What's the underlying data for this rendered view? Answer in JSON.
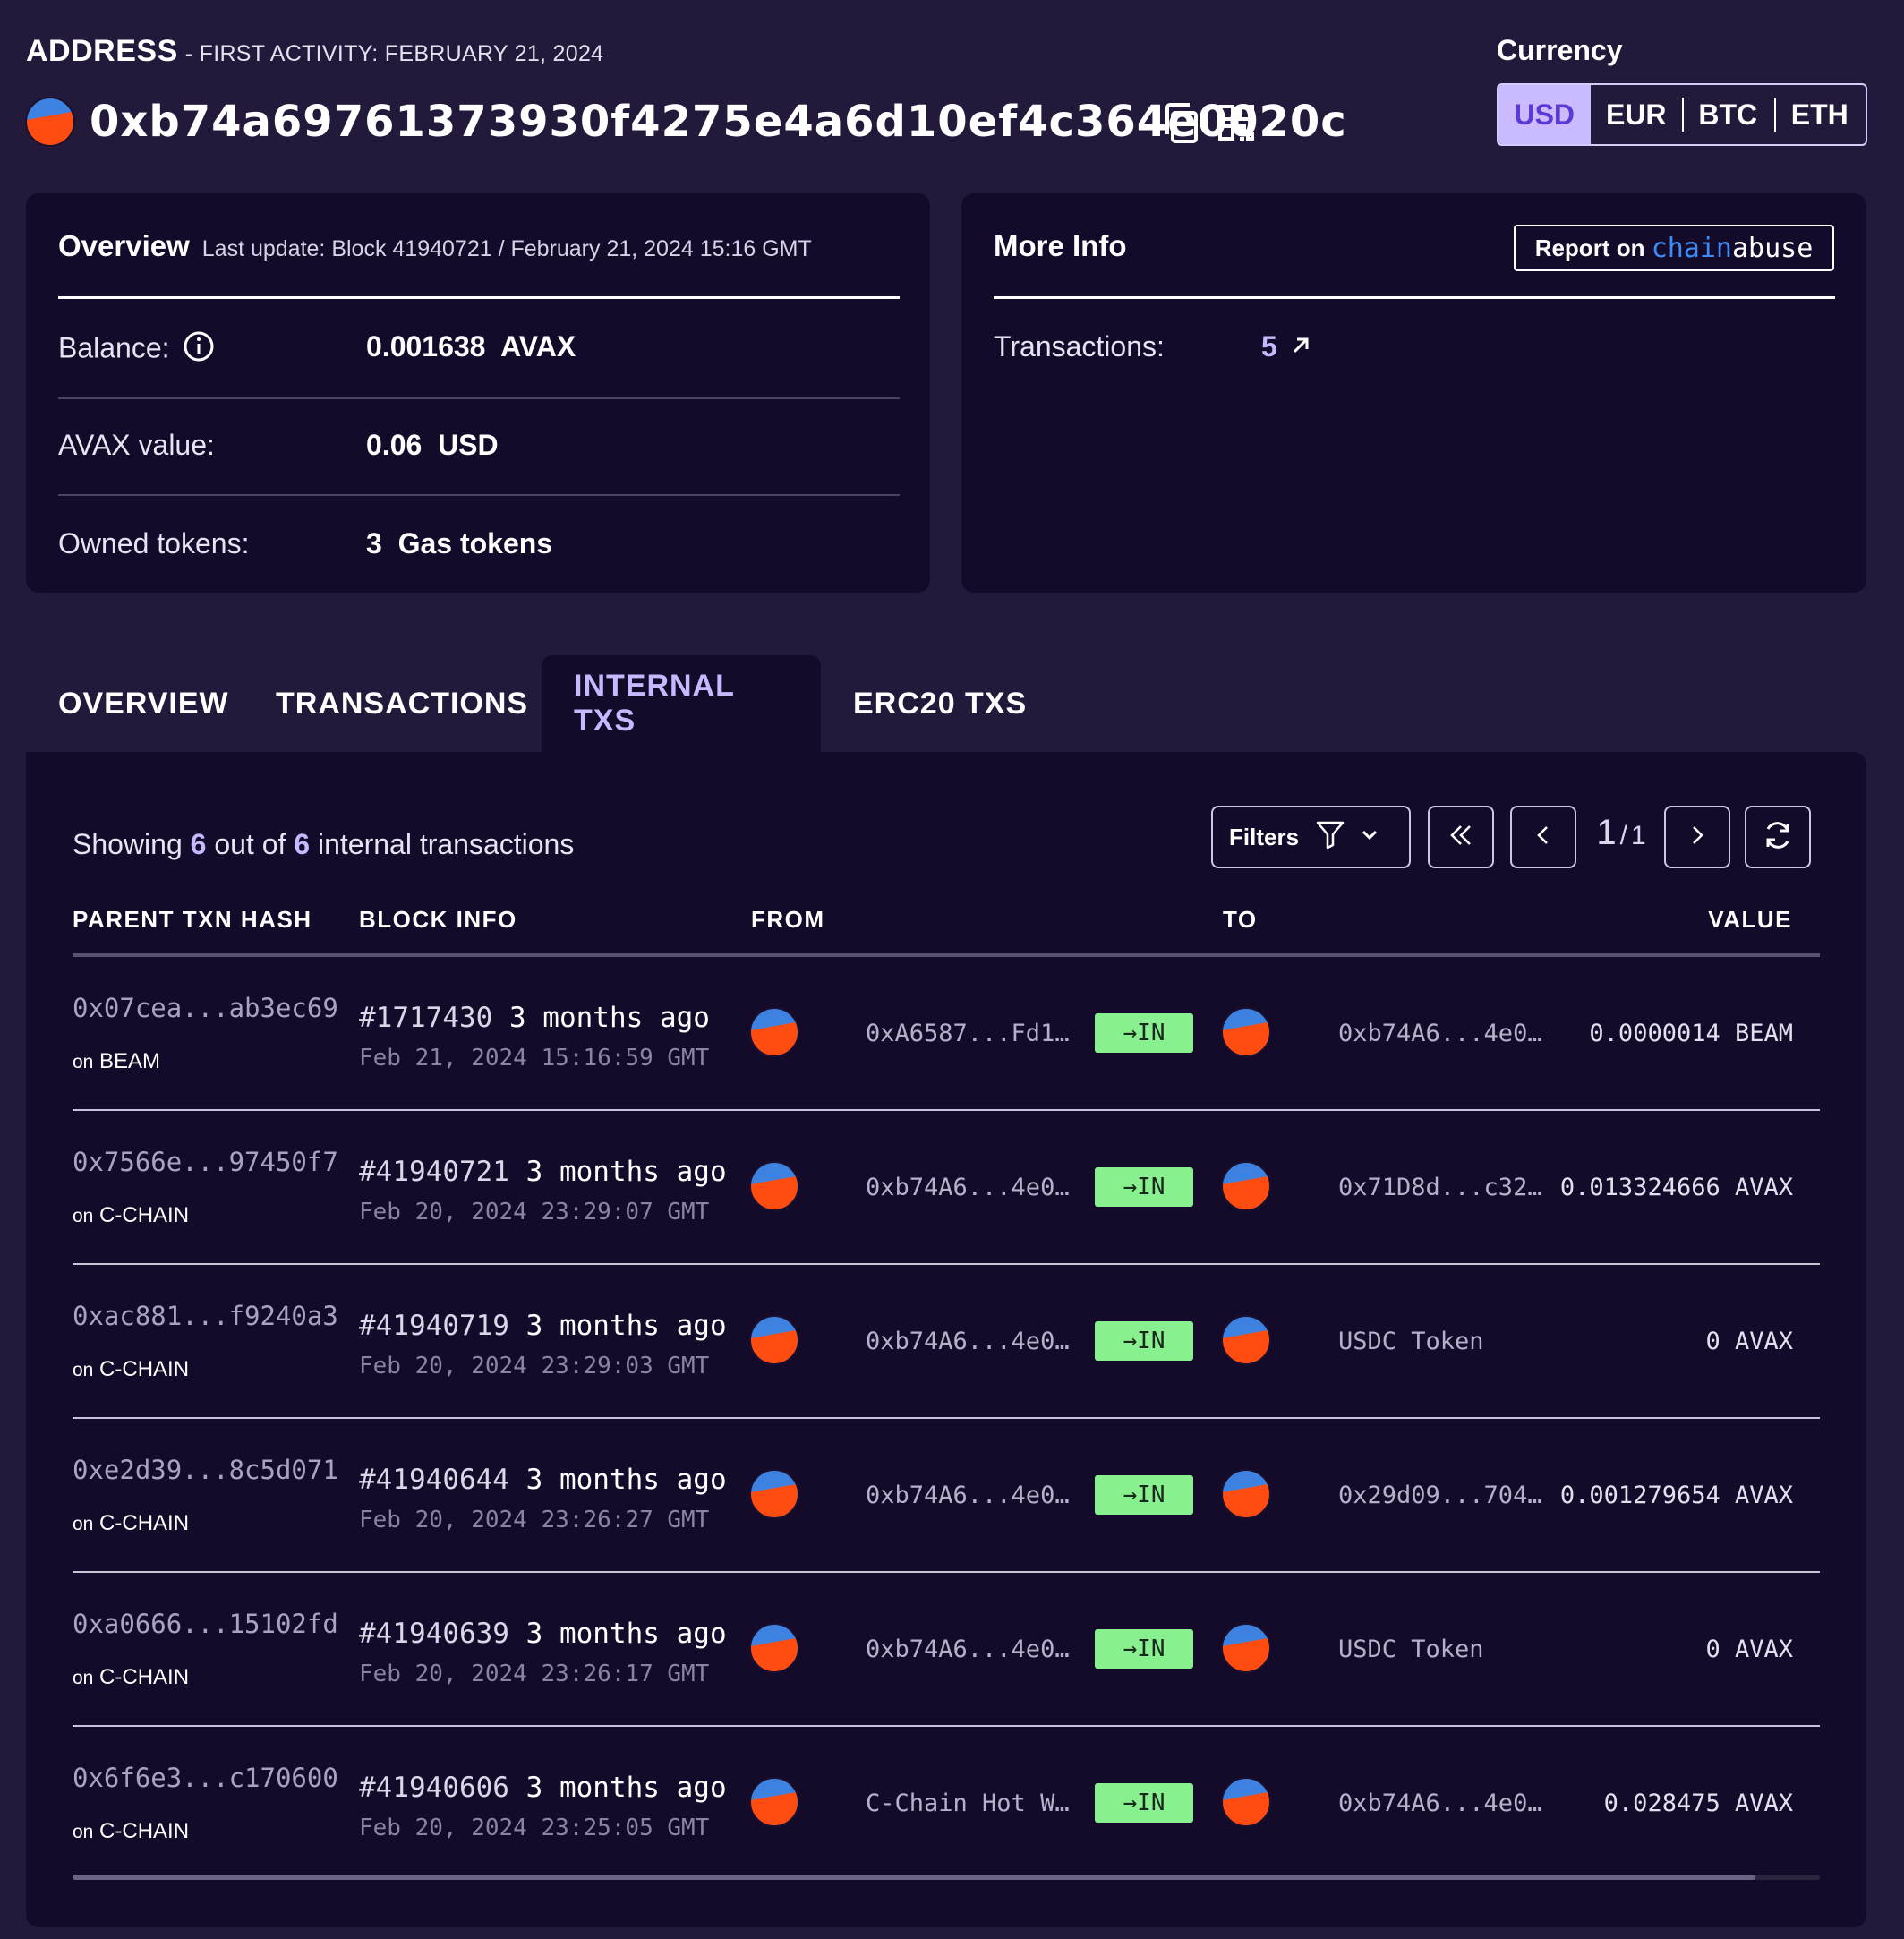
{
  "header": {
    "address_label": "ADDRESS",
    "first_activity": "- FIRST ACTIVITY: FEBRUARY 21, 2024",
    "address": "0xb74a69761373930f4275e4a6d10ef4c364e0020c",
    "copy_icon": "copy-icon",
    "qr_icon": "qr-code-icon"
  },
  "currency": {
    "label": "Currency",
    "options": [
      "USD",
      "EUR",
      "BTC",
      "ETH"
    ],
    "selected": "USD"
  },
  "overview": {
    "title": "Overview",
    "last_update": "Last update: Block 41940721 / February 21, 2024 15:16 GMT",
    "balance_label": "Balance:",
    "balance_value": "0.001638  AVAX",
    "avax_value_label": "AVAX value:",
    "avax_value": "0.06  USD",
    "owned_tokens_label": "Owned tokens:",
    "owned_tokens_count": "3",
    "owned_tokens_text": "Gas tokens"
  },
  "more_info": {
    "title": "More Info",
    "report_prefix": "Report on",
    "report_brand_a": "chain",
    "report_brand_b": "abuse",
    "transactions_label": "Transactions:",
    "transactions_value": "5"
  },
  "tabs": [
    "OVERVIEW",
    "TRANSACTIONS",
    "INTERNAL TXS",
    "ERC20 TXS"
  ],
  "active_tab": "INTERNAL TXS",
  "table": {
    "showing_prefix": "Showing",
    "showing_count": "6",
    "showing_mid": "out of",
    "showing_total": "6",
    "showing_suffix": "internal transactions",
    "filters_label": "Filters",
    "page_current": "1",
    "page_sep": "/",
    "page_total": "1",
    "columns": [
      "PARENT TXN HASH",
      "BLOCK INFO",
      "FROM",
      "TO",
      "VALUE"
    ],
    "rows": [
      {
        "hash": "0x07cea...ab3ec69",
        "chain_prefix": "on",
        "chain": "BEAM",
        "block": "#1717430",
        "age": "3 months ago",
        "date": "Feb 21, 2024 15:16:59 GMT",
        "from": "0xA6587...Fd1…",
        "direction": "→IN",
        "to": "0xb74A6...4e0…",
        "value": "0.0000014 BEAM"
      },
      {
        "hash": "0x7566e...97450f7",
        "chain_prefix": "on",
        "chain": "C-CHAIN",
        "block": "#41940721",
        "age": "3 months ago",
        "date": "Feb 20, 2024 23:29:07 GMT",
        "from": "0xb74A6...4e0…",
        "direction": "→IN",
        "to": "0x71D8d...c32…",
        "value": "0.013324666 AVAX"
      },
      {
        "hash": "0xac881...f9240a3",
        "chain_prefix": "on",
        "chain": "C-CHAIN",
        "block": "#41940719",
        "age": "3 months ago",
        "date": "Feb 20, 2024 23:29:03 GMT",
        "from": "0xb74A6...4e0…",
        "direction": "→IN",
        "to": "USDC Token",
        "value": "0 AVAX"
      },
      {
        "hash": "0xe2d39...8c5d071",
        "chain_prefix": "on",
        "chain": "C-CHAIN",
        "block": "#41940644",
        "age": "3 months ago",
        "date": "Feb 20, 2024 23:26:27 GMT",
        "from": "0xb74A6...4e0…",
        "direction": "→IN",
        "to": "0x29d09...704…",
        "value": "0.001279654 AVAX"
      },
      {
        "hash": "0xa0666...15102fd",
        "chain_prefix": "on",
        "chain": "C-CHAIN",
        "block": "#41940639",
        "age": "3 months ago",
        "date": "Feb 20, 2024 23:26:17 GMT",
        "from": "0xb74A6...4e0…",
        "direction": "→IN",
        "to": "USDC Token",
        "value": "0 AVAX"
      },
      {
        "hash": "0x6f6e3...c170600",
        "chain_prefix": "on",
        "chain": "C-CHAIN",
        "block": "#41940606",
        "age": "3 months ago",
        "date": "Feb 20, 2024 23:25:05 GMT",
        "from": "C-Chain Hot W…",
        "direction": "→IN",
        "to": "0xb74A6...4e0…",
        "value": "0.028475 AVAX"
      }
    ]
  },
  "colors": {
    "page_bg": "#231a3b",
    "card_bg": "#140b2a",
    "accent": "#c7b8ff",
    "in_badge": "#89f08f",
    "avatar_top": "#3d82e0",
    "avatar_bottom": "#ff4d12"
  }
}
